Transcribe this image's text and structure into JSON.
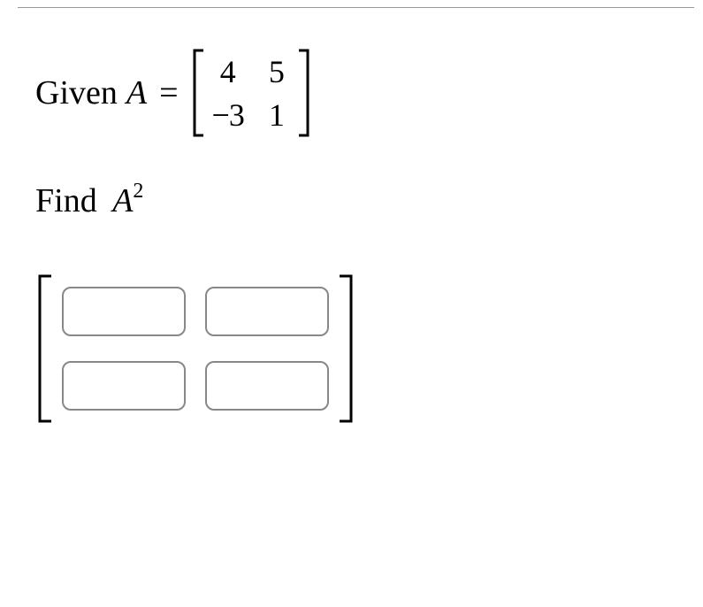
{
  "problem": {
    "given_text": "Given",
    "var_name": "A",
    "equals": "=",
    "matrix": {
      "r1c1": "4",
      "r1c2": "5",
      "r2c1": "−3",
      "r2c2": "1"
    },
    "find_text": "Find",
    "target": "A",
    "exponent": "2"
  },
  "answer": {
    "cells": {
      "r1c1": "",
      "r1c2": "",
      "r2c1": "",
      "r2c2": ""
    }
  }
}
